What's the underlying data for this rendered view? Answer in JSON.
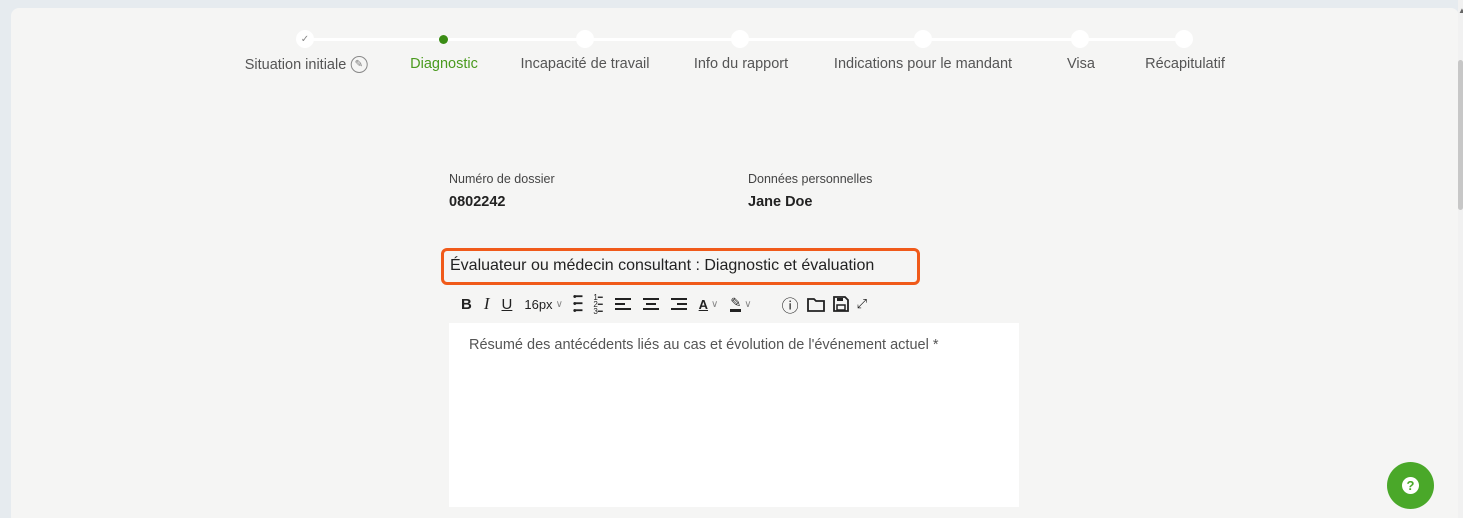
{
  "stepper": {
    "steps": [
      {
        "label": "Situation initiale",
        "state": "done"
      },
      {
        "label": "Diagnostic",
        "state": "active"
      },
      {
        "label": "Incapacité de travail",
        "state": "pending"
      },
      {
        "label": "Info du rapport",
        "state": "pending"
      },
      {
        "label": "Indications pour le mandant",
        "state": "pending"
      },
      {
        "label": "Visa",
        "state": "pending"
      },
      {
        "label": "Récapitulatif",
        "state": "pending"
      }
    ],
    "check_glyph": "✓",
    "edit_glyph": "✎"
  },
  "dossier": {
    "number_label": "Numéro de dossier",
    "number_value": "0802242",
    "personal_label": "Données personnelles",
    "personal_value": "Jane Doe"
  },
  "section": {
    "title": "Évaluateur ou médecin consultant : Diagnostic et évaluation"
  },
  "editor": {
    "toolbar": {
      "bold": "B",
      "italic": "I",
      "underline": "U",
      "font_size": "16px",
      "text_color": "A",
      "info_glyph": "ⓘ"
    },
    "placeholder": "Résumé des antécédents liés au cas et évolution de l'événement actuel *"
  },
  "help": {
    "glyph": "?"
  },
  "colors": {
    "accent_green": "#4aa829",
    "highlight_orange": "#f05a1a"
  }
}
